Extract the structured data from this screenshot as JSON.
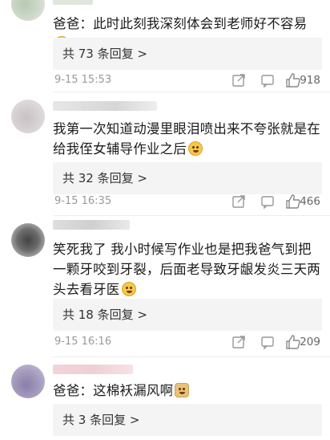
{
  "comments": [
    {
      "text": "爸爸：此时此刻我深刻体会到老师好不容易",
      "replies": "共 73 条回复 >",
      "time": "9-15 15:53",
      "likes": "918",
      "emoji_icon": "crying-face"
    },
    {
      "text": "我第一次知道动漫里眼泪喷出来不夸张就是在给我侄女辅导作业之后",
      "replies": "共 32 条回复 >",
      "time": "9-15 16:35",
      "likes": "466",
      "emoji_icon": "tears-of-joy-face"
    },
    {
      "text": "笑死我了 我小时候写作业也是把我爸气到把一颗牙咬到牙裂，后面老导致牙龈发炎三天两头去看牙医",
      "replies": "共 18 条回复 >",
      "time": "9-15 16:16",
      "likes": "209",
      "emoji_icon": "dizzy-face"
    },
    {
      "text": "爸爸：这棉袄漏风啊",
      "replies": "共 3 条回复 >",
      "emoji_icon": "doge-face"
    }
  ]
}
